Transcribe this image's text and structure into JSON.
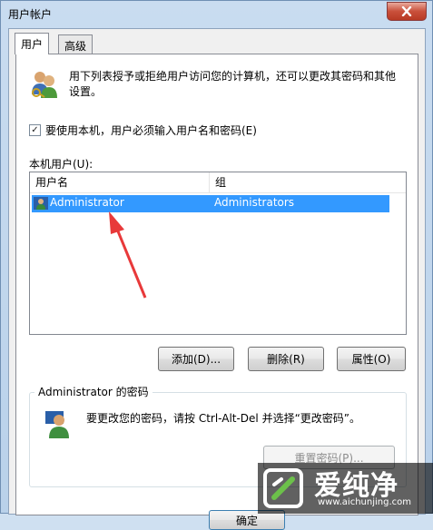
{
  "window": {
    "title": "用户帐户"
  },
  "tabs": [
    {
      "label": "用户"
    },
    {
      "label": "高级"
    }
  ],
  "description": "用下列表授予或拒绝用户访问您的计算机，还可以更改其密码和其他设置。",
  "require_login": {
    "label": "要使用本机，用户必须输入用户名和密码(E)",
    "checked": true
  },
  "local_users": {
    "label": "本机用户(U):",
    "columns": [
      "用户名",
      "组"
    ],
    "rows": [
      {
        "name": "Administrator",
        "group": "Administrators",
        "selected": true
      }
    ]
  },
  "buttons": {
    "add": "添加(D)...",
    "remove": "删除(R)",
    "properties": "属性(O)"
  },
  "password": {
    "group_title": "Administrator 的密码",
    "text": "要更改您的密码，请按 Ctrl-Alt-Del 并选择“更改密码”。",
    "reset_button": "重置密码(P)..."
  },
  "footer": {
    "ok": "确定"
  },
  "watermark": {
    "title": "爱纯净",
    "url": "www.aichunjing.com"
  },
  "colors": {
    "selection": "#3399ff",
    "annotation_arrow": "#e8393a"
  }
}
